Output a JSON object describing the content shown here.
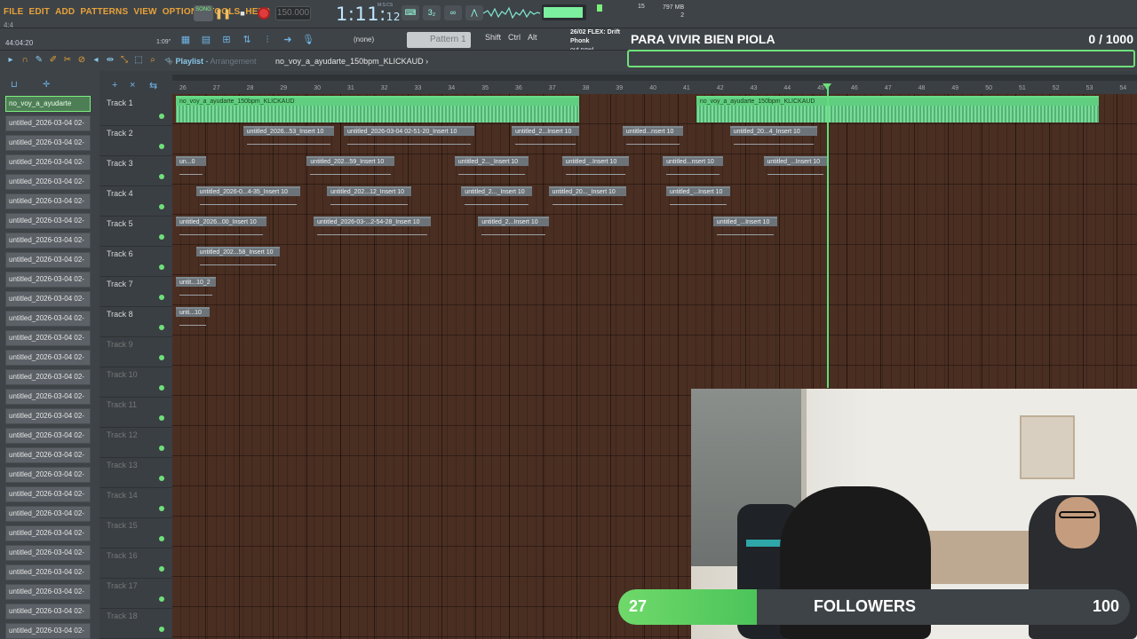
{
  "menu": [
    "FILE",
    "EDIT",
    "ADD",
    "PATTERNS",
    "VIEW",
    "OPTIONS",
    "TOOLS",
    "HELP"
  ],
  "transport": {
    "song_label": "SONG",
    "tempo": "150.000",
    "clock_main": "1:11",
    "clock_sub": "12",
    "mcs": "M:S:CS"
  },
  "toolbar2": {
    "time_left": "44:04:20",
    "beat": "1:09\"",
    "none_label": "(none)",
    "pattern": "Pattern 1",
    "keys": [
      "Shift",
      "Ctrl",
      "Alt"
    ]
  },
  "stats": {
    "cpu": "15",
    "mem": "797 MB",
    "mem2": "2"
  },
  "news": {
    "line1": "26/02  FLEX: Drift Phonk",
    "line2": "out now!"
  },
  "hint": "4:4",
  "stream": {
    "title": "PARA VIVIR BIEN PIOLA",
    "count": "0 / 1000"
  },
  "playlist": {
    "label": "Playlist",
    "sublabel": "Arrangement",
    "path": "no_voy_a_ayudarte_150bpm_KLICKAUD"
  },
  "clips_panel": {
    "selected": "no_voy_a_ayudarte",
    "items": [
      "untitled_2026-03-04 02-",
      "untitled_2026-03-04 02-",
      "untitled_2026-03-04 02-",
      "untitled_2026-03-04 02-",
      "untitled_2026-03-04 02-",
      "untitled_2026-03-04 02-",
      "untitled_2026-03-04 02-",
      "untitled_2026-03-04 02-",
      "untitled_2026-03-04 02-",
      "untitled_2026-03-04 02-",
      "untitled_2026-03-04 02-",
      "untitled_2026-03-04 02-",
      "untitled_2026-03-04 02-",
      "untitled_2026-03-04 02-",
      "untitled_2026-03-04 02-",
      "untitled_2026-03-04 02-",
      "untitled_2026-03-04 02-",
      "untitled_2026-03-04 02-",
      "untitled_2026-03-04 02-",
      "untitled_2026-03-04 02-",
      "untitled_2026-03-04 02-",
      "untitled_2026-03-04 02-",
      "untitled_2026-03-04 02-",
      "untitled_2026-03-04 02-",
      "untitled_2026-03-04 02-",
      "untitled_2026-03-04 02-",
      "untitled_2026-03-04 02-"
    ]
  },
  "tracks": [
    "Track 1",
    "Track 2",
    "Track 3",
    "Track 4",
    "Track 5",
    "Track 6",
    "Track 7",
    "Track 8",
    "Track 9",
    "Track 10",
    "Track 11",
    "Track 12",
    "Track 13",
    "Track 14",
    "Track 15",
    "Track 16",
    "Track 17",
    "Track 18"
  ],
  "ruler_numbers": [
    "26",
    "27",
    "28",
    "29",
    "30",
    "31",
    "32",
    "33",
    "34",
    "35",
    "36",
    "37",
    "38",
    "39",
    "40",
    "41",
    "42",
    "43",
    "44",
    "45",
    "46",
    "47",
    "48",
    "49",
    "50",
    "51",
    "52",
    "53",
    "54"
  ],
  "arrangement": {
    "bar_start": 26,
    "clips": [
      {
        "track": 0,
        "start": 26,
        "len": 12,
        "label": "no_voy_a_ayudarte_150bpm_KLICKAUD",
        "audio": true
      },
      {
        "track": 0,
        "start": 41.5,
        "len": 12,
        "label": "no_voy_a_ayudarte_150bpm_KLICKAUD",
        "audio": true
      },
      {
        "track": 1,
        "start": 28,
        "len": 2.7,
        "label": "untitled_2026...53_Insert 10"
      },
      {
        "track": 1,
        "start": 31,
        "len": 3.9,
        "label": "untitled_2026-03-04 02-51-20_Insert 10"
      },
      {
        "track": 1,
        "start": 36,
        "len": 2,
        "label": "untitled_2...Insert 10"
      },
      {
        "track": 1,
        "start": 39.3,
        "len": 1.8,
        "label": "untitled...nsert 10"
      },
      {
        "track": 1,
        "start": 42.5,
        "len": 2.6,
        "label": "untitled_20...4_Insert 10"
      },
      {
        "track": 2,
        "start": 26,
        "len": 0.9,
        "label": "un...0"
      },
      {
        "track": 2,
        "start": 29.9,
        "len": 2.6,
        "label": "untitled_202...59_Insert 10"
      },
      {
        "track": 2,
        "start": 34.3,
        "len": 2.2,
        "label": "untitled_2..._Insert 10"
      },
      {
        "track": 2,
        "start": 37.5,
        "len": 2,
        "label": "untitled_..Insert 10"
      },
      {
        "track": 2,
        "start": 40.5,
        "len": 1.8,
        "label": "untitled...nsert 10"
      },
      {
        "track": 2,
        "start": 43.5,
        "len": 1.9,
        "label": "untitled_...Insert 10"
      },
      {
        "track": 3,
        "start": 26.6,
        "len": 3.1,
        "label": "untitled_2026-0...4-35_Insert 10"
      },
      {
        "track": 3,
        "start": 30.5,
        "len": 2.5,
        "label": "untitled_202...12_Insert 10"
      },
      {
        "track": 3,
        "start": 34.5,
        "len": 2.1,
        "label": "untitled_2..._Insert 10"
      },
      {
        "track": 3,
        "start": 37.1,
        "len": 2.3,
        "label": "untitled_20..._Insert 10"
      },
      {
        "track": 3,
        "start": 40.6,
        "len": 1.9,
        "label": "untitled_...Insert 10"
      },
      {
        "track": 4,
        "start": 26,
        "len": 2.7,
        "label": "untitled_2026...00_Insert 10"
      },
      {
        "track": 4,
        "start": 30.1,
        "len": 3.5,
        "label": "untitled_2026-03-...2-54-28_Insert 10"
      },
      {
        "track": 4,
        "start": 35,
        "len": 2.1,
        "label": "untitled_2...Insert 10"
      },
      {
        "track": 4,
        "start": 42,
        "len": 1.9,
        "label": "untitled_...Insert 10"
      },
      {
        "track": 5,
        "start": 26.6,
        "len": 2.5,
        "label": "untitled_202...58_Insert 10"
      },
      {
        "track": 6,
        "start": 26,
        "len": 1.2,
        "label": "untit...10_2"
      },
      {
        "track": 7,
        "start": 26,
        "len": 1,
        "label": "unti...10"
      }
    ]
  },
  "playhead_bar": 45.4,
  "followers": {
    "count": "27",
    "label": "FOLLOWERS",
    "goal": "100",
    "progress": 0.27
  }
}
